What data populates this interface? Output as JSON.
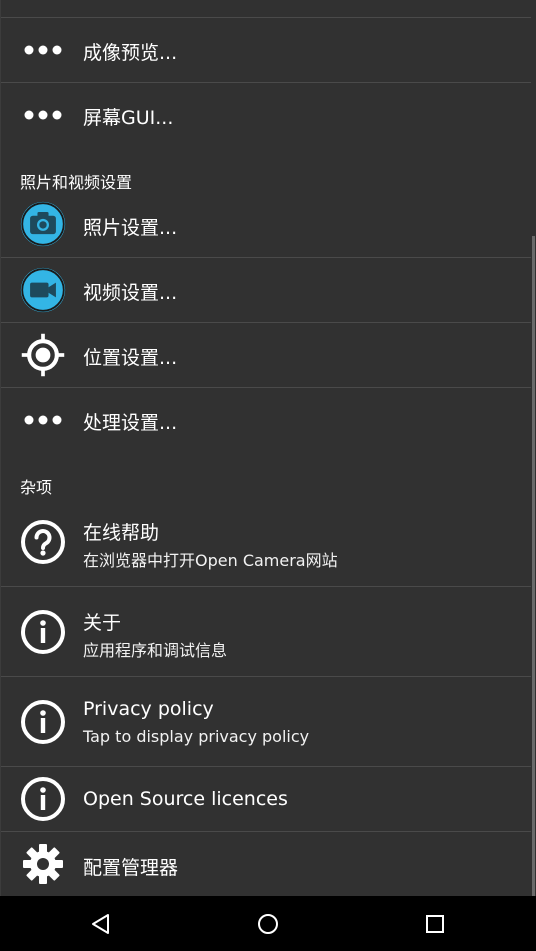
{
  "settings": {
    "items": [
      {
        "title": "成像预览...",
        "icon": "more-dots-icon"
      },
      {
        "title": "屏幕GUI...",
        "icon": "more-dots-icon"
      }
    ],
    "photo_video_section": "照片和视频设置",
    "photo_video_items": [
      {
        "title": "照片设置...",
        "icon": "camera-icon"
      },
      {
        "title": "视频设置...",
        "icon": "videocam-icon"
      },
      {
        "title": "位置设置...",
        "icon": "gps-icon"
      },
      {
        "title": "处理设置...",
        "icon": "more-dots-icon"
      }
    ],
    "misc_section": "杂项",
    "misc_items": [
      {
        "title": "在线帮助",
        "subtitle": "在浏览器中打开Open Camera网站",
        "icon": "help-icon"
      },
      {
        "title": "关于",
        "subtitle": "应用程序和调试信息",
        "icon": "info-icon"
      },
      {
        "title": "Privacy policy",
        "subtitle": "Tap to display privacy policy",
        "icon": "info-icon"
      },
      {
        "title": "Open Source licences",
        "icon": "info-icon"
      },
      {
        "title": "配置管理器",
        "icon": "settings-gear-icon"
      }
    ]
  },
  "colors": {
    "background": "#313131",
    "accent_blue": "#33b5e5",
    "divider": "#4a4a4a",
    "navbar": "#000000"
  },
  "navbar": {
    "back": "back-triangle-icon",
    "home": "home-circle-icon",
    "recents": "recents-square-icon"
  }
}
